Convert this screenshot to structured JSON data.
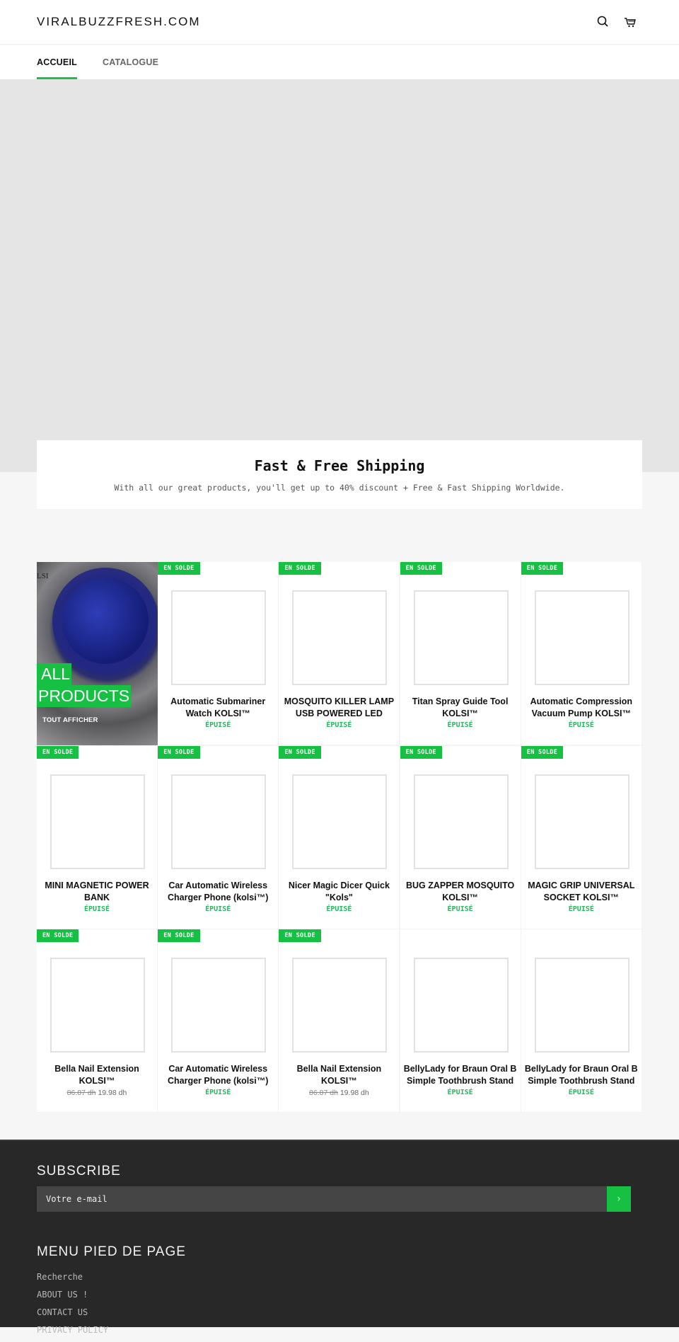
{
  "header": {
    "logo": "VIRALBUZZFRESH.COM",
    "icons": [
      "search-icon",
      "cart-icon"
    ]
  },
  "nav": {
    "items": [
      {
        "label": "ACCUEIL",
        "active": true
      },
      {
        "label": "CATALOGUE",
        "active": false
      }
    ]
  },
  "shipping": {
    "title": "Fast & Free Shipping",
    "subtitle": "With all our great products, you'll get up to 40% discount + Free & Fast Shipping Worldwide."
  },
  "collection": {
    "title_line1": "ALL",
    "title_line2": "PRODUCTS",
    "view_all": "TOUT AFFICHER",
    "brand_mark": "LSI"
  },
  "badge_label": "EN SOLDE",
  "products": [
    {
      "name": "Automatic Submariner Watch KOLSI™",
      "sale": true,
      "status": "ÉPUISÉ"
    },
    {
      "name": "MOSQUITO KILLER LAMP USB POWERED LED",
      "sale": true,
      "status": "ÉPUISÉ"
    },
    {
      "name": "Titan Spray Guide Tool KOLSI™",
      "sale": true,
      "status": "ÉPUISÉ"
    },
    {
      "name": "Automatic Compression Vacuum Pump KOLSI™",
      "sale": true,
      "status": "ÉPUISÉ"
    },
    {
      "name": "MINI MAGNETIC POWER BANK",
      "sale": true,
      "status": "ÉPUISÉ"
    },
    {
      "name": "Car Automatic Wireless Charger Phone (kolsi™)",
      "sale": true,
      "status": "ÉPUISÉ"
    },
    {
      "name": "Nicer Magic Dicer Quick \"Kols\"",
      "sale": true,
      "status": "ÉPUISÉ"
    },
    {
      "name": "BUG ZAPPER MOSQUITO KOLSI™",
      "sale": true,
      "status": "ÉPUISÉ"
    },
    {
      "name": "MAGIC GRIP UNIVERSAL SOCKET KOLSI™",
      "sale": true,
      "status": "ÉPUISÉ"
    },
    {
      "name": "Bella Nail Extension KOLSI™",
      "sale": true,
      "price_old": "86.87 dh",
      "price_new": "19.98 dh"
    },
    {
      "name": "Car Automatic Wireless Charger Phone (kolsi™)",
      "sale": true,
      "status": "ÉPUISÉ"
    },
    {
      "name": "Bella Nail Extension KOLSI™",
      "sale": true,
      "price_old": "86.87 dh",
      "price_new": "19.98 dh"
    },
    {
      "name": "BellyLady for Braun Oral B Simple Toothbrush Stand",
      "sale": false,
      "status": "ÉPUISÉ"
    },
    {
      "name": "BellyLady for Braun Oral B Simple Toothbrush Stand",
      "sale": false,
      "status": "ÉPUISÉ"
    }
  ],
  "footer": {
    "subscribe_heading": "SUBSCRIBE",
    "email_placeholder": "Votre e-mail",
    "submit_icon": "chevron-right-icon",
    "menu_heading": "MENU PIED DE PAGE",
    "links": [
      "Recherche",
      "ABOUT US !",
      "CONTACT US",
      "PRIVACY POLICY"
    ]
  },
  "colors": {
    "accent": "#16c043",
    "status_green": "#27b860",
    "footer_bg": "#282828",
    "hero_bg": "#e5e5e5"
  }
}
